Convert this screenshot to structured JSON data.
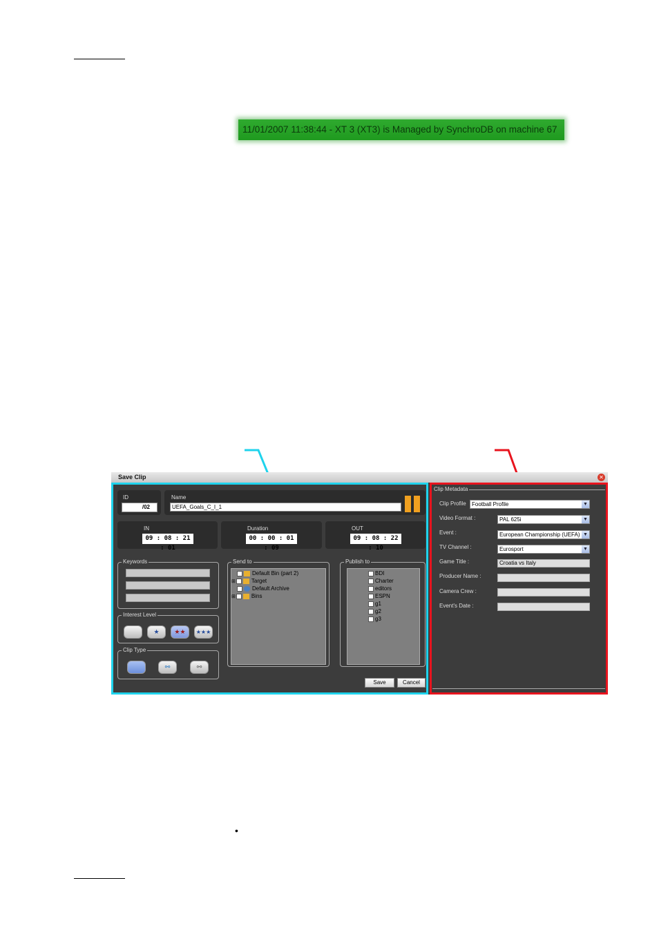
{
  "status_bar": {
    "text": "11/01/2007 11:38:44 - XT 3 (XT3) is Managed by SynchroDB on machine 67"
  },
  "bullet": "•",
  "dialog": {
    "title": "Save Clip",
    "id_label": "ID",
    "id_value": "/02",
    "name_label": "Name",
    "name_value": "UEFA_Goals_C_I_1",
    "in_label": "IN",
    "in_value": "09 : 08 : 21 : 01",
    "duration_label": "Duration",
    "duration_value": "00 : 00 : 01 : 09",
    "out_label": "OUT",
    "out_value": "09 : 08 : 22 : 10",
    "keywords_label": "Keywords",
    "interest_label": "Interest Level",
    "clip_type_label": "Clip Type",
    "send_to_label": "Send to",
    "send_to_items": [
      "Default Bin (part 2)",
      "Target",
      "Default Archive",
      "Bins"
    ],
    "publish_to_label": "Publish to",
    "publish_to_items": [
      "BDI",
      "Charter",
      "editors",
      "ESPN",
      "g1",
      "g2",
      "g3"
    ],
    "save_label": "Save",
    "cancel_label": "Cancel"
  },
  "metadata": {
    "group_label": "Clip Metadata",
    "clip_profile_label": "Clip Profile",
    "clip_profile_value": "Football Profile",
    "video_format_label": "Video Format :",
    "video_format_value": "PAL 625i",
    "event_label": "Event :",
    "event_value": "European Championship (UEFA)",
    "tv_channel_label": "TV Channel :",
    "tv_channel_value": "Eurosport",
    "game_title_label": "Game Title :",
    "game_title_value": "Croatia vs Italy",
    "producer_label": "Producer Name :",
    "camera_label": "Camera Crew :",
    "events_date_label": "Event's Date :"
  }
}
